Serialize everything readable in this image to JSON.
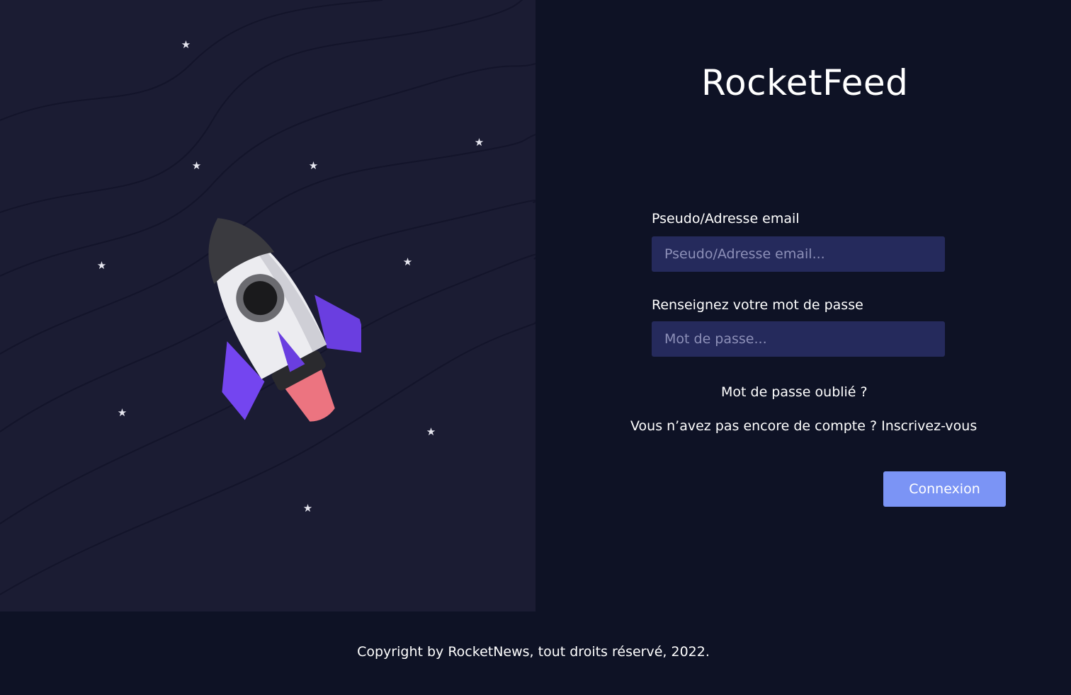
{
  "brand": {
    "title": "RocketFeed"
  },
  "login_form": {
    "username_label": "Pseudo/Adresse email",
    "username_placeholder": "Pseudo/Adresse email...",
    "username_value": "",
    "password_label": "Renseignez votre mot de passe",
    "password_placeholder": "Mot de passe...",
    "password_value": "",
    "forgot_password_link": "Mot de passe oublié ?",
    "signup_prompt": "Vous n’avez pas encore de compte ? Inscrivez-vous",
    "submit_label": "Connexion"
  },
  "footer": {
    "copyright": "Copyright by RocketNews, tout droits réservé, 2022."
  },
  "illustration": {
    "icons": [
      "rocket-icon",
      "star-icon"
    ]
  },
  "colors": {
    "left_panel_bg": "#1b1c33",
    "right_panel_bg": "#0e1225",
    "input_bg": "#252a5c",
    "button_bg": "#7b94f5",
    "rocket_fins": "#7445f0",
    "rocket_flame": "#ec7480"
  }
}
